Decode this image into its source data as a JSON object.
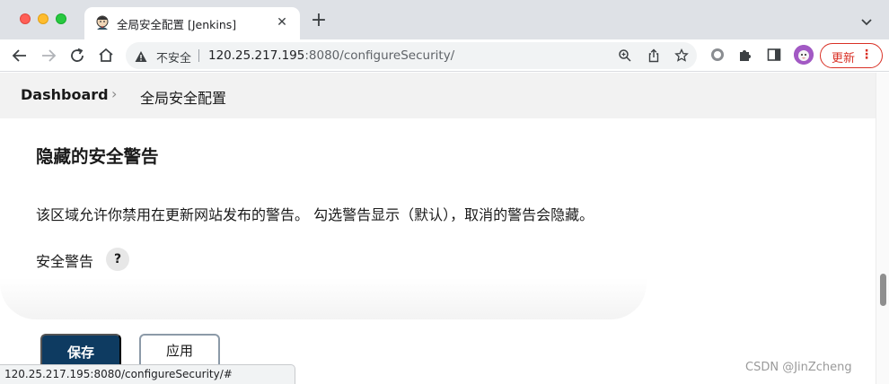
{
  "browser": {
    "tab": {
      "title": "全局安全配置 [Jenkins]"
    },
    "new_tab_label": "+",
    "insecure_label": "不安全",
    "url": {
      "host": "120.25.217.195",
      "port": ":8080",
      "path": "/configureSecurity/"
    },
    "update_button": "更新",
    "status_url": "120.25.217.195:8080/configureSecurity/#"
  },
  "breadcrumb": {
    "home": "Dashboard",
    "separator": "›",
    "current": "全局安全配置"
  },
  "section": {
    "title": "隐藏的安全警告",
    "description": "该区域允许你禁用在更新网站发布的警告。 勾选警告显示（默认），取消的警告会隐藏。",
    "field_label": "安全警告",
    "help": "?"
  },
  "actions": {
    "save": "保存",
    "apply": "应用"
  },
  "watermark": "CSDN @JinZcheng",
  "colors": {
    "primary": "#0e3b61",
    "breadcrumb_bg": "#f2f2f2",
    "update_red": "#d93025"
  }
}
